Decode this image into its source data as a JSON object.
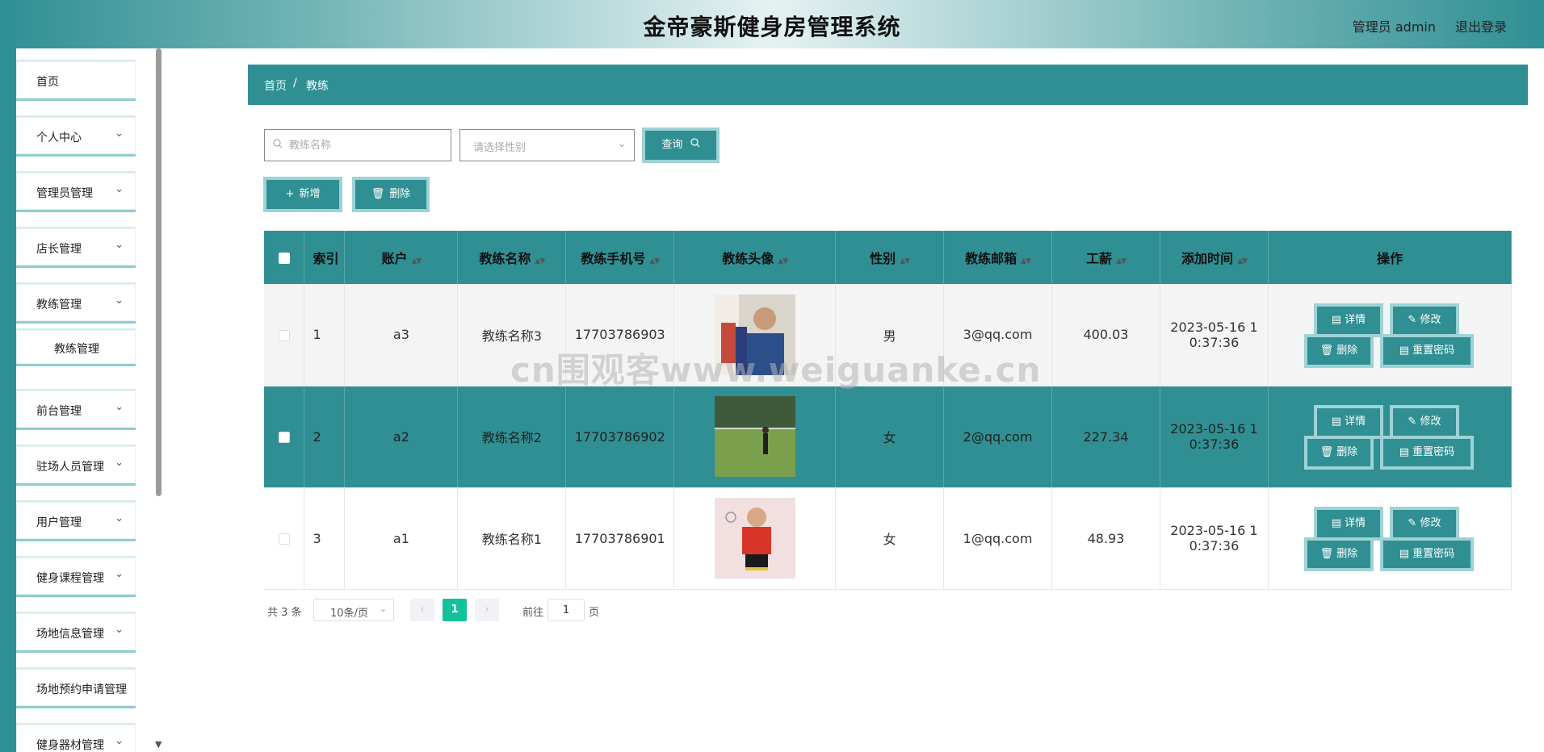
{
  "header": {
    "title": "金帝豪斯健身房管理系统",
    "user": "管理员 admin",
    "logout": "退出登录"
  },
  "sidebar": {
    "items": [
      {
        "label": "首页",
        "chevron": ""
      },
      {
        "label": "个人中心",
        "chevron": "⌄"
      },
      {
        "label": "管理员管理",
        "chevron": "⌄"
      },
      {
        "label": "店长管理",
        "chevron": "⌄"
      },
      {
        "label": "教练管理",
        "chevron": "⌄"
      },
      {
        "label": "教练管理",
        "chevron": ""
      },
      {
        "label": "前台管理",
        "chevron": "⌄"
      },
      {
        "label": "驻场人员管理",
        "chevron": "⌄"
      },
      {
        "label": "用户管理",
        "chevron": "⌄"
      },
      {
        "label": "健身课程管理",
        "chevron": "⌄"
      },
      {
        "label": "场地信息管理",
        "chevron": "⌄"
      },
      {
        "label": "场地预约申请管理",
        "chevron": ""
      },
      {
        "label": "健身器材管理",
        "chevron": "⌄"
      }
    ]
  },
  "breadcrumb": {
    "home": "首页",
    "sep": "/",
    "current": "教练"
  },
  "search": {
    "placeholder": "教练名称",
    "gender_placeholder": "请选择性别",
    "query_label": "查询",
    "search_icon": "search-icon"
  },
  "actions": {
    "add_label": "新增",
    "delete_label": "删除"
  },
  "table": {
    "headers": [
      "索引",
      "账户",
      "教练名称",
      "教练手机号",
      "教练头像",
      "性别",
      "教练邮箱",
      "工薪",
      "添加时间",
      "操作"
    ],
    "rows": [
      {
        "index": "1",
        "account": "a3",
        "name": "教练名称3",
        "phone": "17703786903",
        "gender": "男",
        "email": "3@qq.com",
        "salary": "400.03",
        "time_1": "2023-05-16 1",
        "time_2": "0:37:36"
      },
      {
        "index": "2",
        "account": "a2",
        "name": "教练名称2",
        "phone": "17703786902",
        "gender": "女",
        "email": "2@qq.com",
        "salary": "227.34",
        "time_1": "2023-05-16 1",
        "time_2": "0:37:36"
      },
      {
        "index": "3",
        "account": "a1",
        "name": "教练名称1",
        "phone": "17703786901",
        "gender": "女",
        "email": "1@qq.com",
        "salary": "48.93",
        "time_1": "2023-05-16 1",
        "time_2": "0:37:36"
      }
    ],
    "ops": {
      "detail": "详情",
      "edit": "修改",
      "delete": "删除",
      "reset": "重置密码"
    }
  },
  "pagination": {
    "total": "共 3 条",
    "page_size": "10条/页",
    "current": "1",
    "goto_prefix": "前往",
    "goto_value": "1",
    "goto_suffix": "页"
  },
  "watermark": "cn围观客www.weiguanke.cn",
  "colors": {
    "primary": "#2f8f93",
    "accent_shadow": "#9dd3d6",
    "pager_active": "#13c29a"
  }
}
